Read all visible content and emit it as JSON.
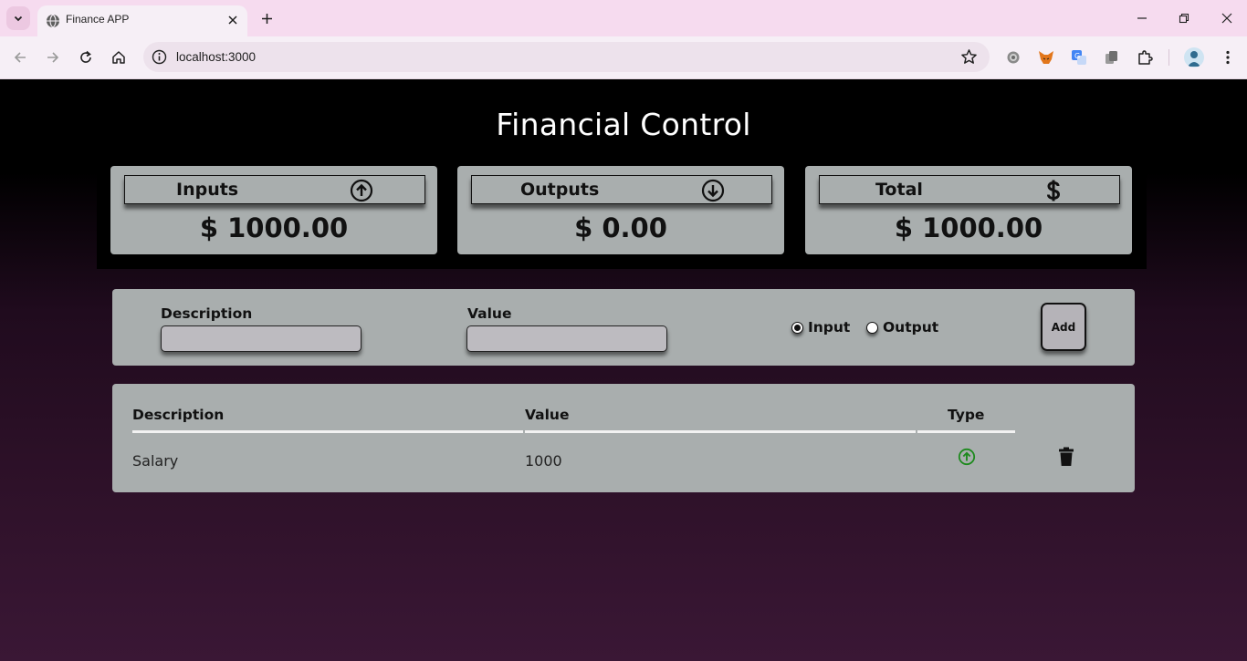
{
  "browser": {
    "tab_title": "Finance APP",
    "url": "localhost:3000"
  },
  "page": {
    "title": "Financial Control"
  },
  "summary": [
    {
      "label": "Inputs",
      "value": "$ 1000.00",
      "icon": "arrow-up-circle-icon"
    },
    {
      "label": "Outputs",
      "value": "$ 0.00",
      "icon": "arrow-down-circle-icon"
    },
    {
      "label": "Total",
      "value": "$ 1000.00",
      "icon": "dollar-icon"
    }
  ],
  "form": {
    "description_label": "Description",
    "description_value": "",
    "value_label": "Value",
    "value_value": "",
    "radio_input_label": "Input",
    "radio_output_label": "Output",
    "selected_type": "Input",
    "add_label": "Add"
  },
  "table": {
    "headers": [
      "Description",
      "Value",
      "Type"
    ],
    "rows": [
      {
        "description": "Salary",
        "value": "1000",
        "type": "Input",
        "type_icon": "arrow-up-circle-icon",
        "action_icon": "trash-icon"
      }
    ]
  },
  "colors": {
    "panel": "#a9aeae",
    "input_type_icon": "#1e8a1e",
    "tabstrip": "#f6dbef"
  }
}
